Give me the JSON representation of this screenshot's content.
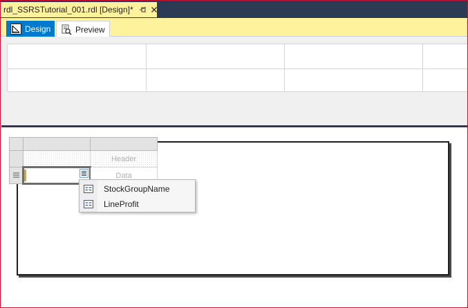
{
  "document_tab": {
    "title": "rdl_SSRSTutorial_001.rdl [Design]*",
    "icons": [
      "pin-icon",
      "close-icon"
    ]
  },
  "view_tabs": [
    {
      "label": "Design",
      "icon": "design-ruler-icon",
      "active": true
    },
    {
      "label": "Preview",
      "icon": "preview-icon",
      "active": false
    }
  ],
  "tablix": {
    "header_cell": "Header",
    "data_cell": "Data"
  },
  "field_list": {
    "items": [
      {
        "label": "StockGroupName",
        "icon": "field-icon"
      },
      {
        "label": "LineProfit",
        "icon": "field-icon"
      }
    ]
  },
  "colors": {
    "accent": "#007acc",
    "tab_highlight": "#fff29d",
    "frame": "#2b3a55",
    "window_border": "#c8102e"
  }
}
